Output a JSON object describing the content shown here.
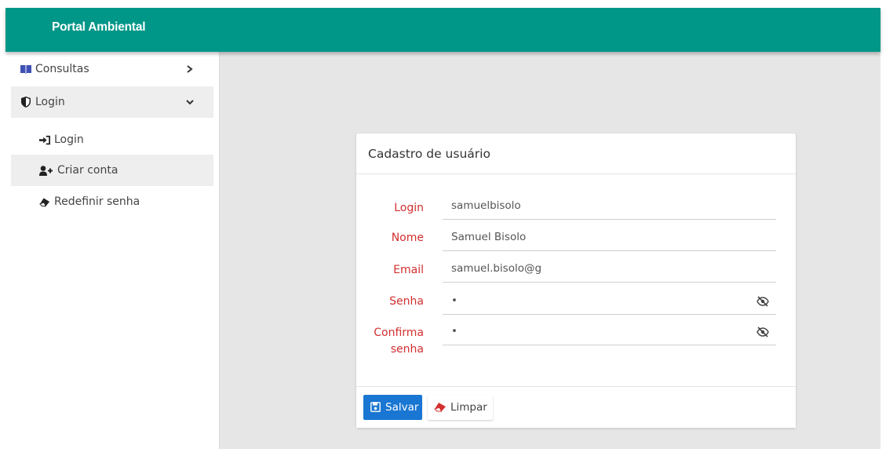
{
  "header": {
    "brand": "Portal Ambiental"
  },
  "sidebar": {
    "items": [
      {
        "label": "Consultas",
        "icon": "book-icon",
        "chevron": "chevron-right-icon"
      },
      {
        "label": "Login",
        "icon": "shield-icon",
        "chevron": "chevron-down-icon"
      },
      {
        "label": "Login",
        "icon": "sign-in-icon"
      },
      {
        "label": "Criar conta",
        "icon": "user-plus-icon"
      },
      {
        "label": "Redefinir senha",
        "icon": "eraser-icon"
      }
    ]
  },
  "form": {
    "title": "Cadastro de usuário",
    "fields": [
      {
        "label": "Login",
        "value": "samuelbisolo"
      },
      {
        "label": "Nome",
        "value": "Samuel Bisolo"
      },
      {
        "label": "Email",
        "value": "samuel.bisolo@g"
      },
      {
        "label": "Senha",
        "value": "•"
      },
      {
        "label": "Confirma senha",
        "value": "•"
      }
    ],
    "save_label": "Salvar",
    "clear_label": "Limpar"
  },
  "colors": {
    "topbar": "#009688",
    "primary_button": "#1976d2",
    "label": "#d32f2f",
    "content_bg": "#e6e6e6"
  }
}
